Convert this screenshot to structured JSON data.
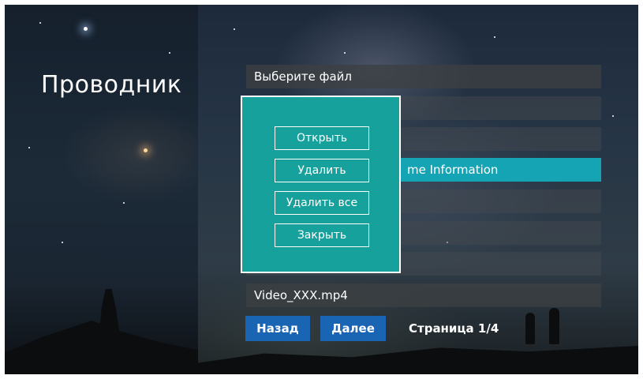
{
  "app": {
    "title": "Проводник"
  },
  "file_list": {
    "header": "Выберите файл",
    "rows": [
      {
        "label": ""
      },
      {
        "label": ""
      },
      {
        "label": "me Information"
      },
      {
        "label": ""
      },
      {
        "label": ""
      },
      {
        "label": ""
      },
      {
        "label": "Video_XXX.mp4"
      }
    ],
    "selected_index": 2
  },
  "navigation": {
    "back_label": "Назад",
    "next_label": "Далее",
    "page_text": "Страница 1/4"
  },
  "context_menu": {
    "open_label": "Открыть",
    "delete_label": "Удалить",
    "delete_all_label": "Удалить все",
    "close_label": "Закрыть"
  },
  "colors": {
    "selected_row": "#15a4b4",
    "popup_background": "#16a19c",
    "nav_button": "#1a64b4"
  }
}
